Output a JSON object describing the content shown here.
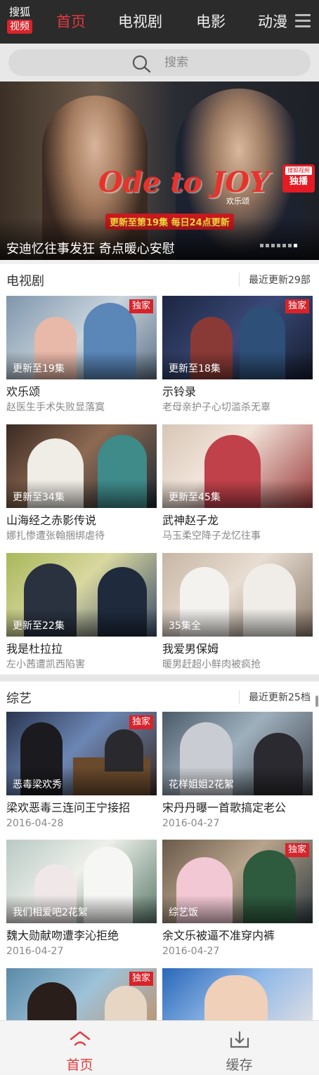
{
  "header": {
    "logo_top": "搜狐",
    "logo_bottom": "视频",
    "tabs": [
      "首页",
      "电视剧",
      "电影",
      "动漫"
    ],
    "active_tab": 0,
    "accent_color": "#e4393c"
  },
  "search": {
    "placeholder": "搜索"
  },
  "banner": {
    "title_art": "Ode to JOY",
    "title_cn": "欢乐颂",
    "update_text": "更新至第19集 每日24点更新",
    "badge_top": "搜狐视频",
    "badge_bottom": "独播",
    "caption": "安迪忆往事发狂 奇点暖心安慰",
    "page_count": 7,
    "active_page": 6
  },
  "tv": {
    "title": "电视剧",
    "more": "最近更新29部",
    "items": [
      {
        "caption": "更新至19集",
        "exclusive": "独家",
        "title": "欢乐颂",
        "subtitle": "赵医生手术失败显落寞"
      },
      {
        "caption": "更新至18集",
        "exclusive": "独家",
        "title": "示铃录",
        "subtitle": "老母亲护子心切滥杀无辜"
      },
      {
        "caption": "更新至34集",
        "exclusive": "",
        "title": "山海经之赤影传说",
        "subtitle": "娜扎惨遭张翰捆绑虐待"
      },
      {
        "caption": "更新至45集",
        "exclusive": "",
        "title": "武神赵子龙",
        "subtitle": "马玉柔空降子龙忆往事"
      },
      {
        "caption": "更新至22集",
        "exclusive": "",
        "title": "我是杜拉拉",
        "subtitle": "左小茜遭凯西陷害"
      },
      {
        "caption": "35集全",
        "exclusive": "",
        "title": "我爱男保姆",
        "subtitle": "暖男赶超小鲜肉被疯抢"
      }
    ]
  },
  "variety": {
    "title": "综艺",
    "more": "最近更新25档",
    "items": [
      {
        "caption": "恶毒梁欢秀",
        "exclusive": "独家",
        "title": "梁欢恶毒三连问王宁接招",
        "subtitle": "2016-04-28"
      },
      {
        "caption": "花样姐姐2花絮",
        "exclusive": "",
        "title": "宋丹丹曝一首歌搞定老公",
        "subtitle": "2016-04-27"
      },
      {
        "caption": "我们相爱吧2花絮",
        "exclusive": "",
        "title": "魏大勋献吻遭李沁拒绝",
        "subtitle": "2016-04-27"
      },
      {
        "caption": "综艺饭",
        "exclusive": "独家",
        "title": "余文乐被逼不准穿内裤",
        "subtitle": "2016-04-27"
      },
      {
        "caption": "",
        "exclusive": "独家",
        "title": "",
        "subtitle": ""
      },
      {
        "caption": "",
        "exclusive": "",
        "title": "",
        "subtitle": ""
      }
    ]
  },
  "tabbar": {
    "home": "首页",
    "cache": "缓存"
  }
}
